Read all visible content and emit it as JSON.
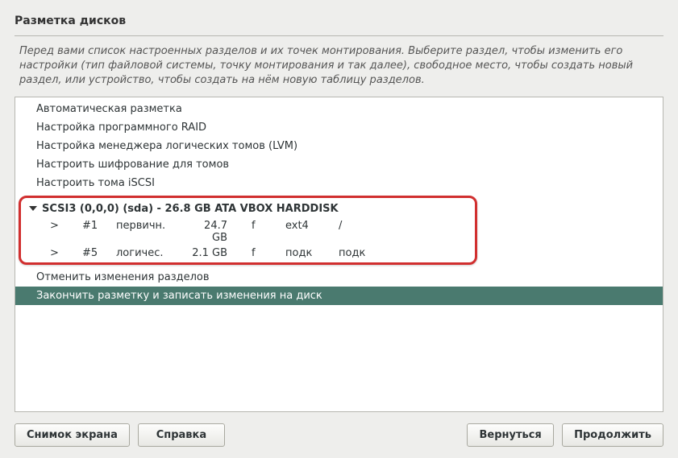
{
  "title": "Разметка дисков",
  "intro": "Перед вами список настроенных разделов и их точек монтирования. Выберите раздел, чтобы изменить его настройки (тип файловой системы, точку монтирования и так далее), свободное место, чтобы создать новый раздел, или устройство, чтобы создать на нём новую таблицу разделов.",
  "menu": {
    "auto": "Автоматическая разметка",
    "raid": "Настройка программного RAID",
    "lvm": "Настройка менеджера логических томов (LVM)",
    "crypt": "Настроить шифрование для томов",
    "iscsi": "Настроить тома iSCSI"
  },
  "disk": {
    "header": "SCSI3 (0,0,0) (sda) - 26.8 GB ATA VBOX HARDDISK",
    "partitions": [
      {
        "arrow": ">",
        "num": "#1",
        "type": "первичн.",
        "size": "24.7 GB",
        "flag": "f",
        "fs": "ext4",
        "mnt": "/"
      },
      {
        "arrow": ">",
        "num": "#5",
        "type": "логичес.",
        "size": "2.1 GB",
        "flag": "f",
        "fs": "подк",
        "mnt": "подк"
      }
    ]
  },
  "actions": {
    "undo": "Отменить изменения разделов",
    "finish": "Закончить разметку и записать изменения на диск"
  },
  "buttons": {
    "screenshot": "Снимок экрана",
    "help": "Справка",
    "back": "Вернуться",
    "continue": "Продолжить"
  }
}
